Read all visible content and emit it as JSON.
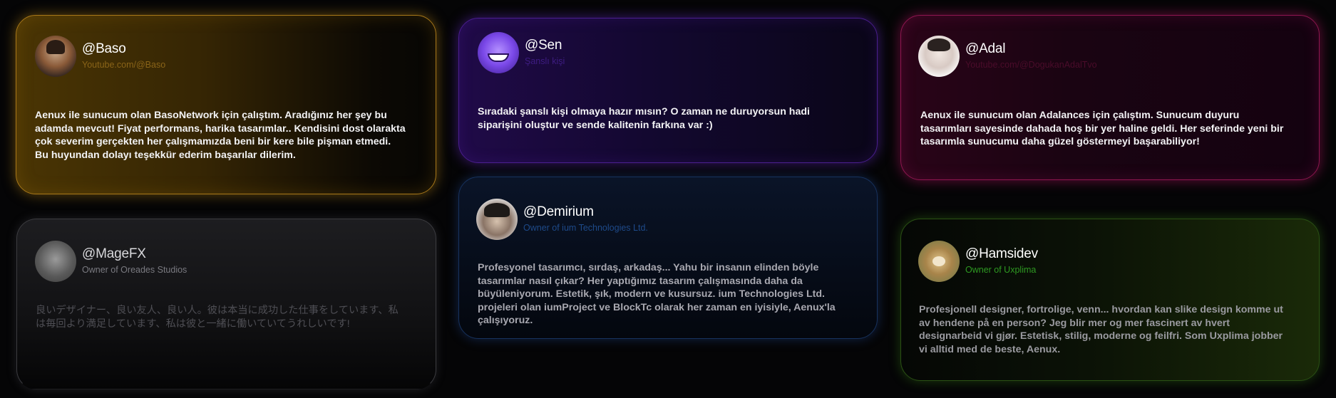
{
  "cards": [
    {
      "handle": "@Baso",
      "subtitle": "Youtube.com/@Baso",
      "text": "Aenux ile sunucum olan BasoNetwork için çalıştım. Aradığınız her şey bu adamda mevcut! Fiyat performans, harika tasarımlar.. Kendisini dost olarakta çok severim gerçekten her çalışmamızda beni bir kere bile pişman etmedi. Bu huyundan dolayı teşekkür ederim başarılar dilerim.",
      "accent": "#a8781a"
    },
    {
      "handle": "@Sen",
      "subtitle": "Şanslı kişi",
      "text": "Sıradaki şanslı kişi olmaya hazır mısın? O zaman ne duruyorsun hadi siparişini oluştur ve sende kalitenin farkına var :)",
      "accent": "#4a1e8e"
    },
    {
      "handle": "@Adal",
      "subtitle": "Youtube.com/@DogukanAdalTvo",
      "text": "Aenux ile sunucum olan Adalances için çalıştım. Sunucum duyuru tasarımları sayesinde dahada hoş bir yer haline geldi. Her seferinde yeni bir tasarımla sunucumu daha güzel göstermeyi başarabiliyor!",
      "accent": "#8e1650"
    },
    {
      "handle": "@MageFX",
      "subtitle": "Owner of Oreades Studios",
      "text": "良いデザイナー、良い友人、良い人。彼は本当に成功した仕事をしています、私は毎回より満足しています、私は彼と一緒に働いていてうれしいです!",
      "accent": "#3c3c40"
    },
    {
      "handle": "@Demirium",
      "subtitle": "Owner of ium Technologies Ltd.",
      "text": "Profesyonel tasarımcı, sırdaş, arkadaş... Yahu bir insanın elinden böyle tasarımlar nasıl çıkar? Her yaptığımız tasarım çalışmasında daha da büyüleniyorum. Estetik, şık, modern ve kusursuz. ium Technologies Ltd. projeleri olan iumProject ve BlockTc olarak her zaman en iyisiyle, Aenux'la çalışıyoruz.",
      "accent": "#17325e"
    },
    {
      "handle": "@Hamsidev",
      "subtitle": "Owner of Uxplima",
      "text": "Profesjonell designer, fortrolige, venn... hvordan kan slike design komme ut av hendene på en person? Jeg blir mer og mer fascinert av hvert designarbeid vi gjør. Estetisk, stilig, moderne og feilfri. Som Uxplima jobber vi alltid med de beste, Aenux.",
      "accent": "#2a5014"
    }
  ]
}
